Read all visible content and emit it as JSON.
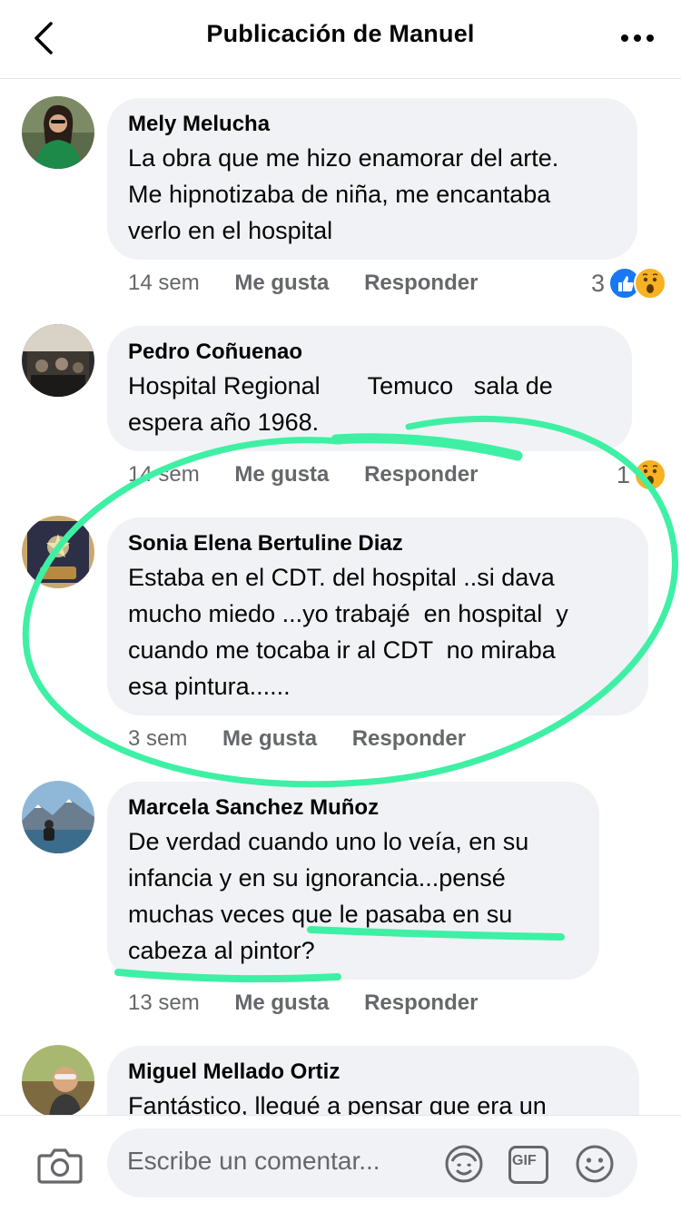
{
  "header": {
    "title": "Publicación de Manuel",
    "back_icon": "chevron-left-icon",
    "more_icon": "more-horizontal-icon"
  },
  "comments": [
    {
      "author": "Mely Melucha",
      "text": "La obra que me hizo enamorar del arte.\nMe hipnotizaba de niña, me encantaba\nverlo en el hospital",
      "time": "14 sem",
      "like": "Me gusta",
      "reply": "Responder",
      "reaction_count": "3",
      "reactions": [
        "like",
        "wow"
      ]
    },
    {
      "author": "Pedro Coñuenao",
      "text": "Hospital Regional       Temuco   sala de\nespera año 1968.",
      "time": "14 sem",
      "like": "Me gusta",
      "reply": "Responder",
      "reaction_count": "1",
      "reactions": [
        "wow"
      ]
    },
    {
      "author": "Sonia Elena Bertuline Diaz",
      "text": "Estaba en el CDT. del hospital ..si dava\nmucho miedo ...yo trabajé  en hospital  y\ncuando me tocaba ir al CDT  no miraba\nesa pintura......",
      "time": "3 sem",
      "like": "Me gusta",
      "reply": "Responder"
    },
    {
      "author": "Marcela Sanchez Muñoz",
      "text": "De verdad cuando uno lo veía, en su\ninfancia y en su ignorancia...pensé\nmuchas veces que le pasaba en su\ncabeza al pintor?",
      "time": "13 sem",
      "like": "Me gusta",
      "reply": "Responder"
    },
    {
      "author": "Miguel Mellado Ortiz",
      "text": "Fantástico, llegué a pensar que era un"
    }
  ],
  "footer": {
    "placeholder": "Escribe un comentar...",
    "camera_icon": "camera-icon",
    "sticker_icon": "avatar-sticker-icon",
    "gif_label": "GIF",
    "emoji_icon": "smiley-icon"
  },
  "colors": {
    "bubble": "#f0f2f5",
    "text_secondary": "#65676b",
    "like_blue": "#1877f2",
    "wow_yellow": "#f7b125",
    "highlight_green": "#3ef0a4"
  }
}
